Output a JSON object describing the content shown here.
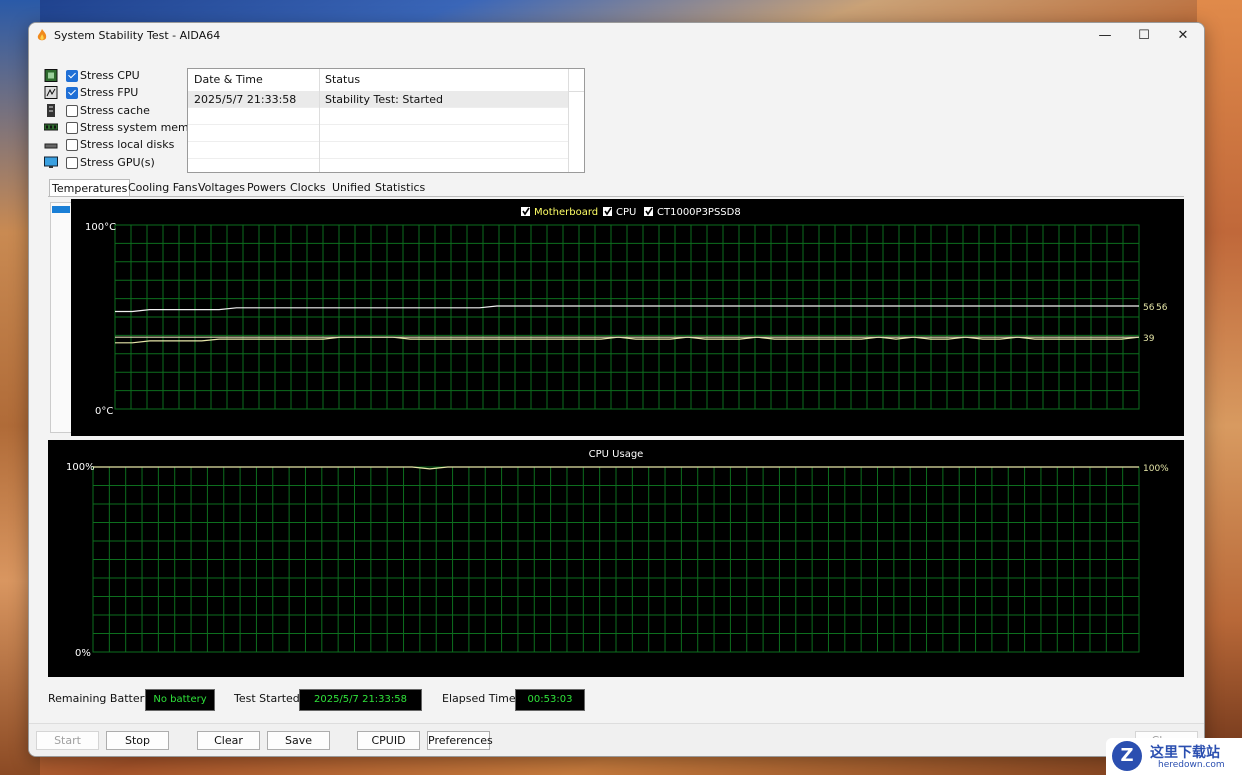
{
  "window": {
    "title": "System Stability Test - AIDA64",
    "minimize": "—",
    "maximize": "☐",
    "close": "✕"
  },
  "stress_options": [
    {
      "label": "Stress CPU",
      "checked": true,
      "icon": "cpu-chip-icon"
    },
    {
      "label": "Stress FPU",
      "checked": true,
      "icon": "fpu-chip-icon"
    },
    {
      "label": "Stress cache",
      "checked": false,
      "icon": "cache-icon"
    },
    {
      "label": "Stress system memory",
      "checked": false,
      "icon": "memory-icon"
    },
    {
      "label": "Stress local disks",
      "checked": false,
      "icon": "disk-icon"
    },
    {
      "label": "Stress GPU(s)",
      "checked": false,
      "icon": "monitor-icon"
    }
  ],
  "log": {
    "headers": [
      "Date & Time",
      "Status"
    ],
    "rows": [
      {
        "time": "2025/5/7 21:33:58",
        "status": "Stability Test: Started"
      }
    ]
  },
  "tabs": [
    "Temperatures",
    "Cooling Fans",
    "Voltages",
    "Powers",
    "Clocks",
    "Unified",
    "Statistics"
  ],
  "active_tab": "Temperatures",
  "chart_data": [
    {
      "type": "line",
      "legend": [
        "Motherboard",
        "CPU",
        "CT1000P3PSSD8"
      ],
      "legend_colors": [
        "#ffff66",
        "#ffffff",
        "#ffffff"
      ],
      "y_top_label": "100°C",
      "y_bottom_label": "0°C",
      "ylim": [
        0,
        100
      ],
      "grid": true,
      "grid_color": "#0d6e1e",
      "series": [
        {
          "name": "CPU",
          "color": "#f0f0f0",
          "values": [
            53,
            53,
            54,
            54,
            54,
            54,
            54,
            55,
            55,
            55,
            55,
            55,
            55,
            55,
            55,
            55,
            55,
            55,
            55,
            55,
            55,
            55,
            56,
            56,
            56,
            56,
            56,
            56,
            56,
            56,
            56,
            56,
            56,
            56,
            56,
            56,
            56,
            56,
            56,
            56,
            56,
            56,
            56,
            56,
            56,
            56,
            56,
            56,
            56,
            56,
            56,
            56,
            56,
            56,
            56,
            56,
            56,
            56,
            56,
            56
          ]
        },
        {
          "name": "Motherboard",
          "color": "#e6e6a8",
          "values": [
            36,
            36,
            37,
            37,
            37,
            37,
            38,
            38,
            38,
            38,
            38,
            38,
            38,
            39,
            39,
            39,
            39,
            38,
            38,
            38,
            38,
            38,
            38,
            38,
            38,
            38,
            38,
            38,
            38,
            39,
            38,
            38,
            38,
            39,
            38,
            38,
            38,
            39,
            38,
            38,
            38,
            38,
            38,
            38,
            39,
            38,
            39,
            38,
            38,
            39,
            38,
            38,
            39,
            38,
            38,
            38,
            38,
            38,
            38,
            39
          ]
        },
        {
          "name": "CT1000P3PSSD8",
          "color": "#d9d9b0",
          "values": [
            39,
            39,
            39,
            39,
            39,
            39,
            39,
            39,
            39,
            39,
            39,
            39,
            39,
            39,
            39,
            39,
            39,
            39,
            39,
            39,
            39,
            39,
            39,
            39,
            39,
            39,
            39,
            39,
            39,
            39,
            39,
            39,
            39,
            39,
            39,
            39,
            39,
            39,
            39,
            39,
            39,
            39,
            39,
            39,
            39,
            39,
            39,
            39,
            39,
            39,
            39,
            39,
            39,
            39,
            39,
            39,
            39,
            39,
            39,
            39
          ]
        }
      ],
      "right_labels": [
        {
          "text": "56",
          "value": 56
        },
        {
          "text": "56",
          "value": 56
        },
        {
          "text": "39",
          "value": 39
        }
      ]
    },
    {
      "type": "line",
      "title": "CPU Usage",
      "y_top_label": "100%",
      "y_bottom_label": "0%",
      "ylim": [
        0,
        100
      ],
      "grid": true,
      "grid_color": "#0d6e1e",
      "series": [
        {
          "name": "CPU Usage",
          "color": "#e6e6a8",
          "values": [
            100,
            100,
            100,
            100,
            100,
            100,
            100,
            100,
            100,
            100,
            100,
            100,
            100,
            100,
            100,
            100,
            100,
            100,
            100,
            99,
            100,
            100,
            100,
            100,
            100,
            100,
            100,
            100,
            100,
            100,
            100,
            100,
            100,
            100,
            100,
            100,
            100,
            100,
            100,
            100,
            100,
            100,
            100,
            100,
            100,
            100,
            100,
            100,
            100,
            100,
            100,
            100,
            100,
            100,
            100,
            100,
            100,
            100,
            100,
            100
          ]
        }
      ],
      "right_labels": [
        {
          "text": "100%",
          "value": 100
        }
      ]
    }
  ],
  "status": {
    "battery_label": "Remaining Battery:",
    "battery_value": "No battery",
    "started_label": "Test Started:",
    "started_value": "2025/5/7 21:33:58",
    "elapsed_label": "Elapsed Time:",
    "elapsed_value": "00:53:03"
  },
  "buttons": {
    "start": "Start",
    "stop": "Stop",
    "clear": "Clear",
    "save": "Save",
    "cpuid": "CPUID",
    "preferences": "Preferences",
    "close": "Close"
  },
  "watermark": {
    "logo": "Z",
    "title": "这里下载站",
    "url": "heredown.com"
  },
  "colors": {
    "chart_bg": "#000000",
    "grid": "#0d6e1e",
    "status_green": "#2fe23a",
    "checkbox_blue": "#1f6fd6"
  }
}
